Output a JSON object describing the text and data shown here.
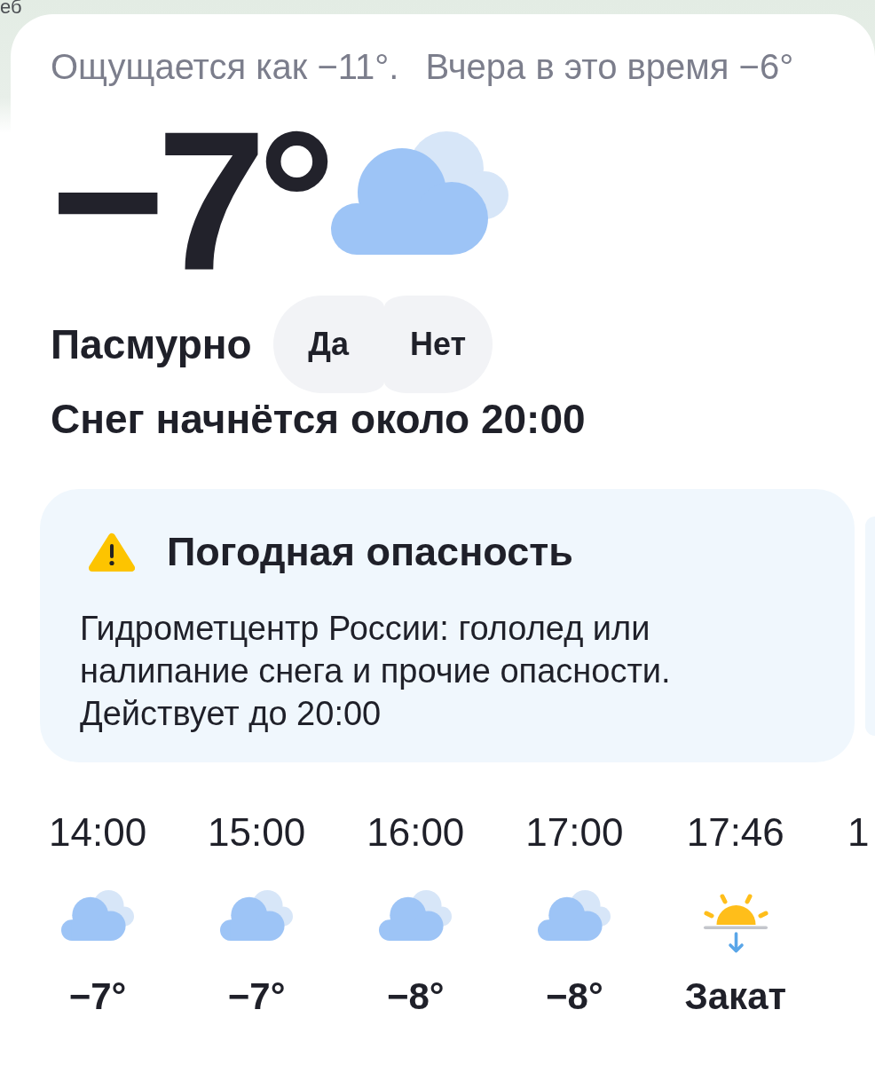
{
  "map_label": "еб",
  "feels_like": "Ощущается как −11°.",
  "yesterday": "Вчера в это время −6°",
  "current": {
    "temperature": "−7°",
    "kind": "cloud",
    "condition": "Пасмурно"
  },
  "feedback_buttons": [
    {
      "label": "Да"
    },
    {
      "label": "Нет"
    }
  ],
  "precipitation_note": "Снег начнётся около 20:00",
  "alert": {
    "title": "Погодная опасность",
    "text": "Гидрометцентр России: гололед или налипание снега и прочие опасности.",
    "valid_until": "Действует до 20:00"
  },
  "hourly": [
    {
      "time": "14:00",
      "kind": "cloud",
      "value": "−7°"
    },
    {
      "time": "15:00",
      "kind": "cloud",
      "value": "−7°"
    },
    {
      "time": "16:00",
      "kind": "cloud",
      "value": "−8°"
    },
    {
      "time": "17:00",
      "kind": "cloud",
      "value": "−8°"
    },
    {
      "time": "17:46",
      "kind": "sunset",
      "value": "Закат"
    },
    {
      "time": "1"
    }
  ]
}
